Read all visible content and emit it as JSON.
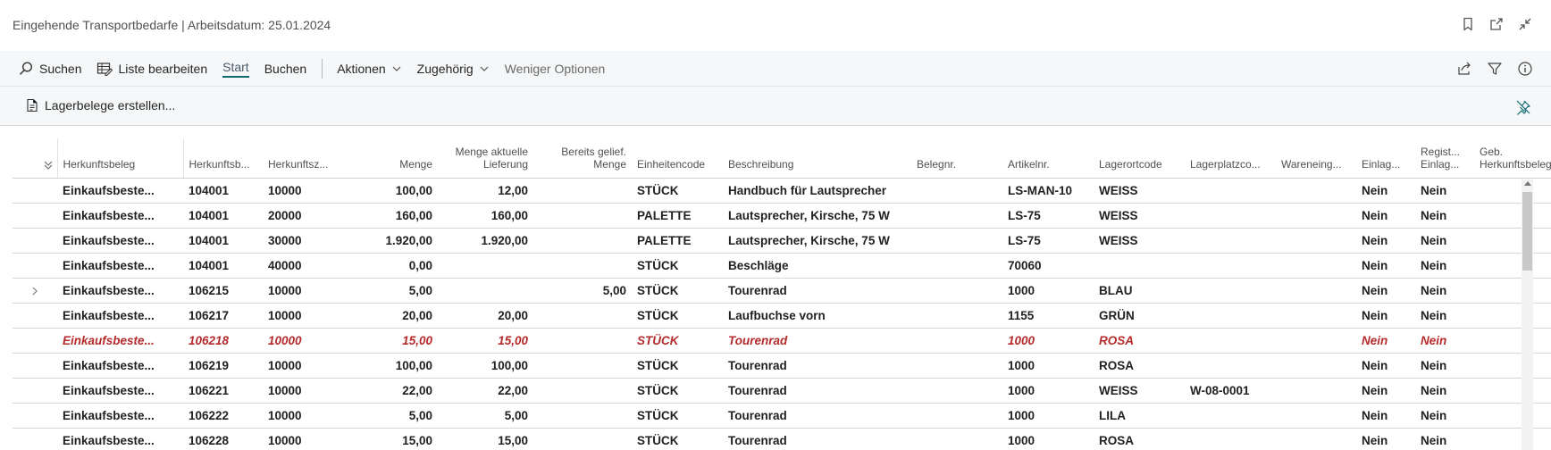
{
  "page": {
    "title": "Eingehende Transportbedarfe | Arbeitsdatum: 25.01.2024"
  },
  "title_icons": [
    "bookmark-icon",
    "open-new-window-icon",
    "collapse-icon"
  ],
  "actionbar": {
    "search_label": "Suchen",
    "edit_list_label": "Liste bearbeiten",
    "tab_start_label": "Start",
    "tab_post_label": "Buchen",
    "actions_label": "Aktionen",
    "related_label": "Zugehörig",
    "fewer_options_label": "Weniger Optionen"
  },
  "subbar": {
    "create_docs_label": "Lagerbelege erstellen..."
  },
  "colors": {
    "accent": "#0c6b70",
    "error_row": "#b52b2b",
    "toolbar_bg": "#f5f7f8"
  },
  "table": {
    "columns": [
      {
        "key": "herkunftsbeleg",
        "label": "Herkunftsbeleg",
        "label2": ""
      },
      {
        "key": "herkunftsbelegnr",
        "label": "Herkunftsb...",
        "label2": ""
      },
      {
        "key": "herkunftszeilennr",
        "label": "Herkunftsz...",
        "label2": ""
      },
      {
        "key": "menge",
        "label": "Menge",
        "label2": ""
      },
      {
        "key": "menge_akt",
        "label": "Menge aktuelle",
        "label2": "Lieferung"
      },
      {
        "key": "bereits",
        "label": "Bereits gelief.",
        "label2": "Menge"
      },
      {
        "key": "einheit",
        "label": "Einheitencode",
        "label2": ""
      },
      {
        "key": "beschreibung",
        "label": "Beschreibung",
        "label2": ""
      },
      {
        "key": "belegnr",
        "label": "Belegnr.",
        "label2": ""
      },
      {
        "key": "artikelnr",
        "label": "Artikelnr.",
        "label2": ""
      },
      {
        "key": "lagerort",
        "label": "Lagerortcode",
        "label2": ""
      },
      {
        "key": "lagerplatz",
        "label": "Lagerplatzco...",
        "label2": ""
      },
      {
        "key": "wareneing",
        "label": "Wareneing...",
        "label2": ""
      },
      {
        "key": "einlag",
        "label": "Einlag...",
        "label2": ""
      },
      {
        "key": "regist",
        "label": "Regist...",
        "label2": "Einlag..."
      },
      {
        "key": "geb",
        "label": "Geb.",
        "label2": "Herkunftsbeleg"
      }
    ],
    "rows": [
      {
        "herkunftsbeleg": "Einkaufsbeste...",
        "herkunftsbelegnr": "104001",
        "herkunftszeilennr": "10000",
        "menge": "100,00",
        "menge_akt": "12,00",
        "bereits": "",
        "einheit": "STÜCK",
        "beschreibung": "Handbuch für Lautsprecher",
        "belegnr": "",
        "artikelnr": "LS-MAN-10",
        "lagerort": "WEISS",
        "lagerplatz": "",
        "wareneing": "",
        "einlag": "Nein",
        "regist": "Nein",
        "geb": "",
        "expand": false,
        "error": false
      },
      {
        "herkunftsbeleg": "Einkaufsbeste...",
        "herkunftsbelegnr": "104001",
        "herkunftszeilennr": "20000",
        "menge": "160,00",
        "menge_akt": "160,00",
        "bereits": "",
        "einheit": "PALETTE",
        "beschreibung": "Lautsprecher, Kirsche, 75 W",
        "belegnr": "",
        "artikelnr": "LS-75",
        "lagerort": "WEISS",
        "lagerplatz": "",
        "wareneing": "",
        "einlag": "Nein",
        "regist": "Nein",
        "geb": "",
        "expand": false,
        "error": false
      },
      {
        "herkunftsbeleg": "Einkaufsbeste...",
        "herkunftsbelegnr": "104001",
        "herkunftszeilennr": "30000",
        "menge": "1.920,00",
        "menge_akt": "1.920,00",
        "bereits": "",
        "einheit": "PALETTE",
        "beschreibung": "Lautsprecher, Kirsche, 75 W",
        "belegnr": "",
        "artikelnr": "LS-75",
        "lagerort": "WEISS",
        "lagerplatz": "",
        "wareneing": "",
        "einlag": "Nein",
        "regist": "Nein",
        "geb": "",
        "expand": false,
        "error": false
      },
      {
        "herkunftsbeleg": "Einkaufsbeste...",
        "herkunftsbelegnr": "104001",
        "herkunftszeilennr": "40000",
        "menge": "0,00",
        "menge_akt": "",
        "bereits": "",
        "einheit": "STÜCK",
        "beschreibung": "Beschläge",
        "belegnr": "",
        "artikelnr": "70060",
        "lagerort": "",
        "lagerplatz": "",
        "wareneing": "",
        "einlag": "Nein",
        "regist": "Nein",
        "geb": "",
        "expand": false,
        "error": false
      },
      {
        "herkunftsbeleg": "Einkaufsbeste...",
        "herkunftsbelegnr": "106215",
        "herkunftszeilennr": "10000",
        "menge": "5,00",
        "menge_akt": "",
        "bereits": "5,00",
        "einheit": "STÜCK",
        "beschreibung": "Tourenrad",
        "belegnr": "",
        "artikelnr": "1000",
        "lagerort": "BLAU",
        "lagerplatz": "",
        "wareneing": "",
        "einlag": "Nein",
        "regist": "Nein",
        "geb": "",
        "expand": true,
        "error": false
      },
      {
        "herkunftsbeleg": "Einkaufsbeste...",
        "herkunftsbelegnr": "106217",
        "herkunftszeilennr": "10000",
        "menge": "20,00",
        "menge_akt": "20,00",
        "bereits": "",
        "einheit": "STÜCK",
        "beschreibung": "Laufbuchse vorn",
        "belegnr": "",
        "artikelnr": "1155",
        "lagerort": "GRÜN",
        "lagerplatz": "",
        "wareneing": "",
        "einlag": "Nein",
        "regist": "Nein",
        "geb": "",
        "expand": false,
        "error": false
      },
      {
        "herkunftsbeleg": "Einkaufsbeste...",
        "herkunftsbelegnr": "106218",
        "herkunftszeilennr": "10000",
        "menge": "15,00",
        "menge_akt": "15,00",
        "bereits": "",
        "einheit": "STÜCK",
        "beschreibung": "Tourenrad",
        "belegnr": "",
        "artikelnr": "1000",
        "lagerort": "ROSA",
        "lagerplatz": "",
        "wareneing": "",
        "einlag": "Nein",
        "regist": "Nein",
        "geb": "",
        "expand": false,
        "error": true
      },
      {
        "herkunftsbeleg": "Einkaufsbeste...",
        "herkunftsbelegnr": "106219",
        "herkunftszeilennr": "10000",
        "menge": "100,00",
        "menge_akt": "100,00",
        "bereits": "",
        "einheit": "STÜCK",
        "beschreibung": "Tourenrad",
        "belegnr": "",
        "artikelnr": "1000",
        "lagerort": "ROSA",
        "lagerplatz": "",
        "wareneing": "",
        "einlag": "Nein",
        "regist": "Nein",
        "geb": "",
        "expand": false,
        "error": false
      },
      {
        "herkunftsbeleg": "Einkaufsbeste...",
        "herkunftsbelegnr": "106221",
        "herkunftszeilennr": "10000",
        "menge": "22,00",
        "menge_akt": "22,00",
        "bereits": "",
        "einheit": "STÜCK",
        "beschreibung": "Tourenrad",
        "belegnr": "",
        "artikelnr": "1000",
        "lagerort": "WEISS",
        "lagerplatz": "W-08-0001",
        "wareneing": "",
        "einlag": "Nein",
        "regist": "Nein",
        "geb": "",
        "expand": false,
        "error": false
      },
      {
        "herkunftsbeleg": "Einkaufsbeste...",
        "herkunftsbelegnr": "106222",
        "herkunftszeilennr": "10000",
        "menge": "5,00",
        "menge_akt": "5,00",
        "bereits": "",
        "einheit": "STÜCK",
        "beschreibung": "Tourenrad",
        "belegnr": "",
        "artikelnr": "1000",
        "lagerort": "LILA",
        "lagerplatz": "",
        "wareneing": "",
        "einlag": "Nein",
        "regist": "Nein",
        "geb": "",
        "expand": false,
        "error": false
      },
      {
        "herkunftsbeleg": "Einkaufsbeste...",
        "herkunftsbelegnr": "106228",
        "herkunftszeilennr": "10000",
        "menge": "15,00",
        "menge_akt": "15,00",
        "bereits": "",
        "einheit": "STÜCK",
        "beschreibung": "Tourenrad",
        "belegnr": "",
        "artikelnr": "1000",
        "lagerort": "ROSA",
        "lagerplatz": "",
        "wareneing": "",
        "einlag": "Nein",
        "regist": "Nein",
        "geb": "",
        "expand": false,
        "error": false
      }
    ]
  }
}
